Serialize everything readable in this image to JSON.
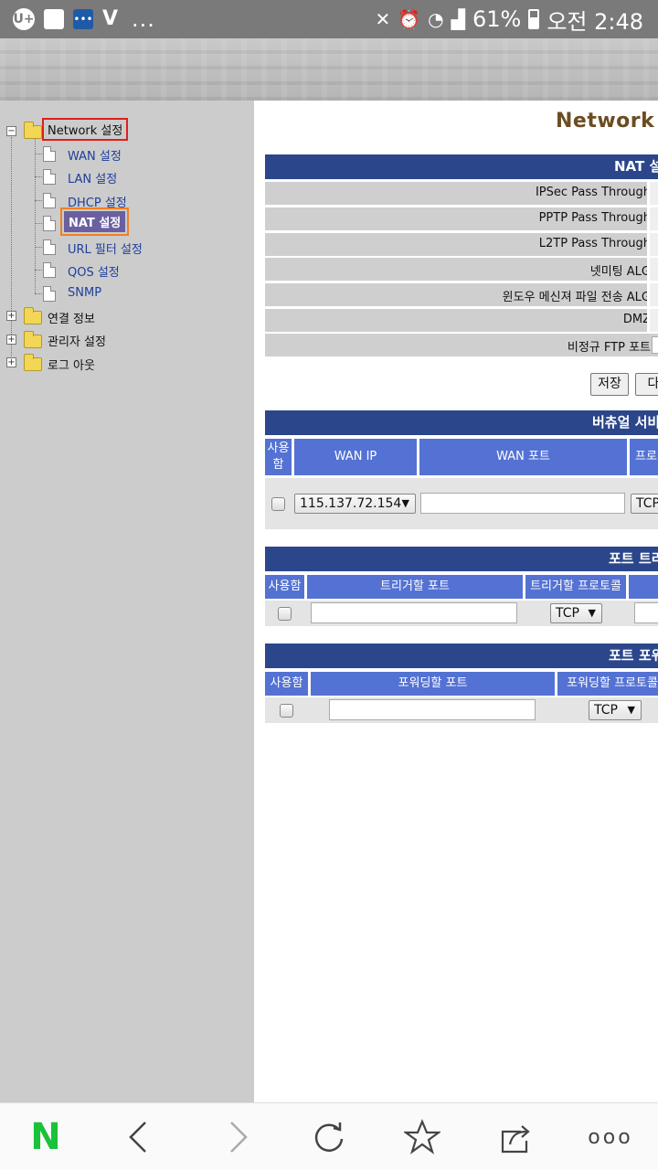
{
  "status_bar": {
    "carrier_icon": "U+",
    "battery": "61%",
    "time": "오전 2:48",
    "dots": "...",
    "icons": [
      "u-plus-icon",
      "gallery-icon",
      "message-icon",
      "v3-icon",
      "mute-icon",
      "alarm-icon",
      "wifi-icon",
      "signal-icon",
      "battery-icon"
    ]
  },
  "sidebar": {
    "root_label": "Network 설정",
    "sub_items": [
      {
        "label": "WAN 설정"
      },
      {
        "label": "LAN 설정"
      },
      {
        "label": "DHCP 설정"
      },
      {
        "label": "NAT 설정",
        "selected": true
      },
      {
        "label": "URL 필터 설정"
      },
      {
        "label": "QOS 설정"
      },
      {
        "label": "SNMP"
      }
    ],
    "top_items": [
      {
        "label": "연결 정보"
      },
      {
        "label": "관리자 설정"
      },
      {
        "label": "로그 아웃"
      }
    ]
  },
  "main": {
    "page_title": "Network S",
    "nat_section": {
      "title": "NAT 설",
      "rows": [
        {
          "label": "IPSec Pass Through"
        },
        {
          "label": "PPTP Pass Through"
        },
        {
          "label": "L2TP Pass Through"
        },
        {
          "label": "넷미팅 ALG"
        },
        {
          "label": "윈도우 메신져 파일 전송 ALG"
        },
        {
          "label": "DMZ"
        },
        {
          "label": "비정규 FTP 포트"
        }
      ],
      "save_label": "저장",
      "next_label": "다"
    },
    "virtual_server": {
      "title": "버츄얼 서비",
      "headers": {
        "use": "사용함",
        "wan_ip": "WAN IP",
        "wan_port": "WAN 포트",
        "protocol": "프로"
      },
      "wan_ip_value": "115.137.72.154",
      "protocol_value": "TCP"
    },
    "port_trigger": {
      "title": "포트 트리",
      "headers": {
        "use": "사용함",
        "trigger_port": "트리거할 포트",
        "trigger_protocol": "트리거할 프로토콜"
      },
      "protocol_value": "TCP"
    },
    "port_forward": {
      "title": "포트 포워",
      "headers": {
        "use": "사용함",
        "forward_port": "포워딩할 포트",
        "forward_protocol": "포워딩할 프로토콜"
      },
      "protocol_value": "TCP"
    }
  },
  "bottom_bar": {
    "home_label": "N",
    "more_label": "ooo",
    "icons": [
      "naver-home-icon",
      "back-icon",
      "forward-icon",
      "refresh-icon",
      "bookmark-star-icon",
      "share-icon",
      "more-icon"
    ]
  },
  "colors": {
    "section_bar": "#2b468a",
    "table_header": "#5472d3",
    "sidebar_bg": "#cccccc",
    "title_brown": "#6b4d22",
    "naver_green": "#19c239"
  }
}
